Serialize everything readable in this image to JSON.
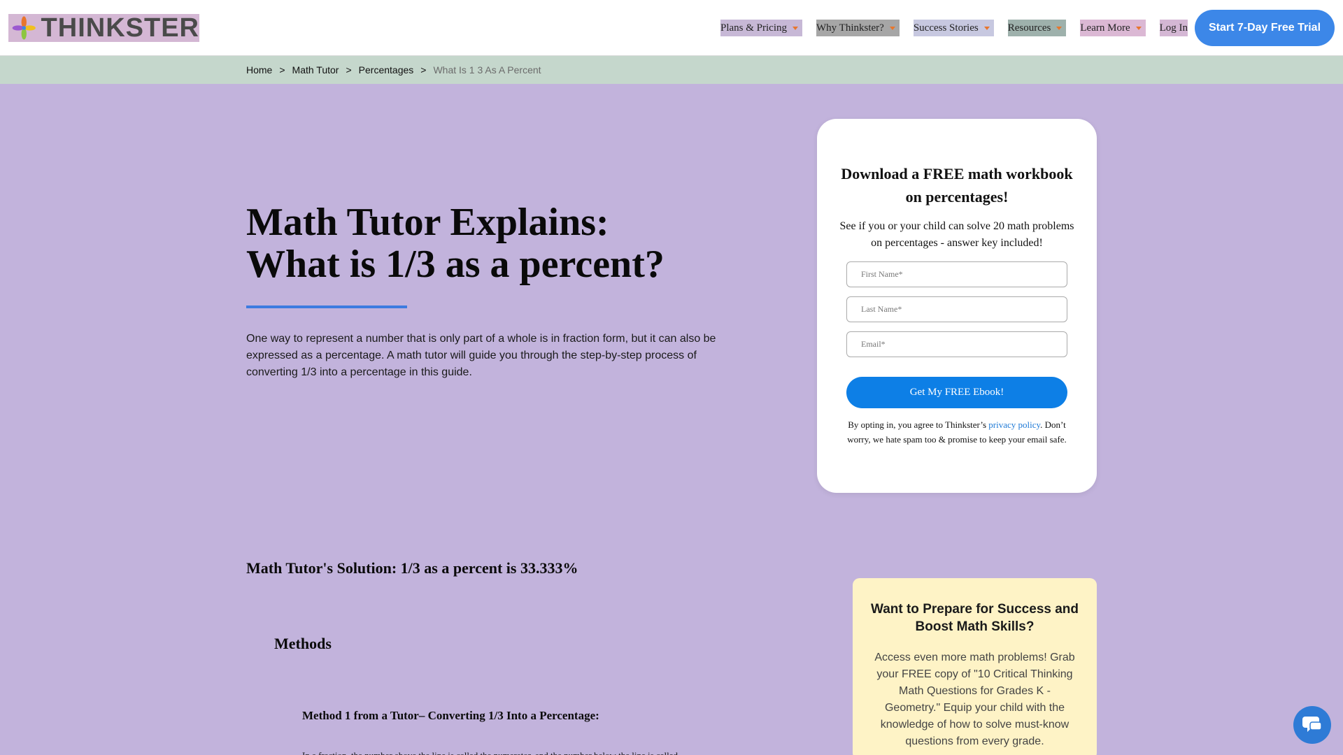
{
  "header": {
    "logo_text": "THINKSTER",
    "nav": [
      {
        "label": "Plans & Pricing",
        "has_caret": true
      },
      {
        "label": "Why Thinkster?",
        "has_caret": true
      },
      {
        "label": "Success Stories",
        "has_caret": true
      },
      {
        "label": "Resources",
        "has_caret": true
      },
      {
        "label": "Learn More",
        "has_caret": true
      },
      {
        "label": "Log In",
        "has_caret": false
      }
    ],
    "cta_label": "Start 7-Day Free Trial"
  },
  "breadcrumb": {
    "items": [
      "Home",
      "Math Tutor",
      "Percentages"
    ],
    "separator": ">",
    "current": "What Is 1 3 As A Percent"
  },
  "hero": {
    "title_line1": "Math Tutor Explains:",
    "title_line2": "What is 1/3 as a percent?",
    "intro": "One way to represent a number that is only part of a whole is in fraction form, but it can also be expressed as a percentage. A math tutor will guide you through the step-by-step process of converting 1/3 into a percentage in this guide."
  },
  "signup_card": {
    "title": "Download a FREE math workbook on percentages!",
    "subtitle": "See if you or your child can solve 20 math problems on percentages - answer key included!",
    "first_name_placeholder": "First Name*",
    "last_name_placeholder": "Last Name*",
    "email_placeholder": "Email*",
    "submit_label": "Get My FREE Ebook!",
    "note_before_link": "By opting in, you agree to Thinkster’s ",
    "privacy_link": "privacy policy",
    "note_after_link": ". Don’t worry, we hate spam too & promise to keep your email safe."
  },
  "content": {
    "solution": "Math Tutor's Solution: 1/3 as a percent is 33.333%",
    "methods_heading": "Methods",
    "method1_heading": "Method 1 from a Tutor– Converting 1/3 Into a Percentage:",
    "method1_text": "In a fraction, the number above the line is called the numerator, and the number below the line is called"
  },
  "promo": {
    "title": "Want to Prepare for Success and Boost Math Skills?",
    "text": "Access even more math problems! Grab your FREE copy of \"10 Critical Thinking Math Questions for Grades K - Geometry.\" Equip your child with the knowledge of how to solve must-know questions from every grade."
  },
  "colors": {
    "page_bg": "#c2b3dc",
    "breadcrumb_bg": "#c5d7cc",
    "cta_blue": "#3c87e8",
    "submit_blue": "#0d7fe6",
    "promo_bg": "#fef3c6",
    "caret_orange": "#e8762c",
    "hero_rule": "#3d7be0"
  },
  "icons": {
    "logo": "thinkster-flower-logo",
    "chat": "chat-bubble-icon"
  }
}
